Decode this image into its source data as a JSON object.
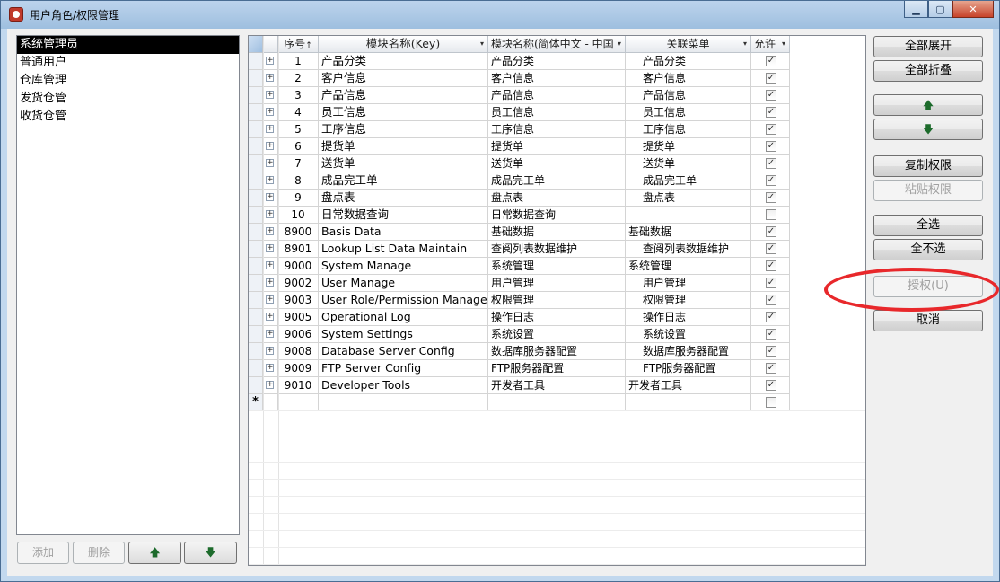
{
  "window": {
    "title": "用户角色/权限管理",
    "controls": {
      "minimize": "▁",
      "maximize": "▢",
      "close": "✕"
    }
  },
  "roles": {
    "items": [
      "系统管理员",
      "普通用户",
      "仓库管理",
      "发货仓管",
      "收货仓管"
    ],
    "selected_index": 0
  },
  "left_buttons": {
    "add": "添加",
    "delete": "删除",
    "up": "🡅",
    "down": "🡇"
  },
  "grid": {
    "columns": {
      "seq": "序号",
      "key": "模块名称(Key)",
      "cn": "模块名称(简体中文 - 中国",
      "menu": "关联菜单",
      "allow": "允许"
    },
    "sort_glyph": "↑",
    "dropdown_glyph": "▾",
    "expand_glyph": "+",
    "check_glyph": "✓",
    "new_row_marker": "*",
    "rows": [
      {
        "seq": "1",
        "key": "产品分类",
        "cn": "产品分类",
        "menu": "产品分类",
        "menu_indent": true,
        "allow": true
      },
      {
        "seq": "2",
        "key": "客户信息",
        "cn": "客户信息",
        "menu": "客户信息",
        "menu_indent": true,
        "allow": true
      },
      {
        "seq": "3",
        "key": "产品信息",
        "cn": "产品信息",
        "menu": "产品信息",
        "menu_indent": true,
        "allow": true
      },
      {
        "seq": "4",
        "key": "员工信息",
        "cn": "员工信息",
        "menu": "员工信息",
        "menu_indent": true,
        "allow": true
      },
      {
        "seq": "5",
        "key": "工序信息",
        "cn": "工序信息",
        "menu": "工序信息",
        "menu_indent": true,
        "allow": true
      },
      {
        "seq": "6",
        "key": "提货单",
        "cn": "提货单",
        "menu": "提货单",
        "menu_indent": true,
        "allow": true
      },
      {
        "seq": "7",
        "key": "送货单",
        "cn": "送货单",
        "menu": "送货单",
        "menu_indent": true,
        "allow": true
      },
      {
        "seq": "8",
        "key": "成品完工单",
        "cn": "成品完工单",
        "menu": "成品完工单",
        "menu_indent": true,
        "allow": true
      },
      {
        "seq": "9",
        "key": "盘点表",
        "cn": "盘点表",
        "menu": "盘点表",
        "menu_indent": true,
        "allow": true
      },
      {
        "seq": "10",
        "key": "日常数据查询",
        "cn": "日常数据查询",
        "menu": "",
        "menu_indent": true,
        "allow": false
      },
      {
        "seq": "8900",
        "key": "Basis Data",
        "cn": "基础数据",
        "menu": "基础数据",
        "menu_indent": false,
        "allow": true
      },
      {
        "seq": "8901",
        "key": "Lookup List Data Maintain",
        "cn": "查阅列表数据维护",
        "menu": "查阅列表数据维护",
        "menu_indent": true,
        "allow": true
      },
      {
        "seq": "9000",
        "key": "System Manage",
        "cn": "系统管理",
        "menu": "系统管理",
        "menu_indent": false,
        "allow": true
      },
      {
        "seq": "9002",
        "key": "User Manage",
        "cn": "用户管理",
        "menu": "用户管理",
        "menu_indent": true,
        "allow": true
      },
      {
        "seq": "9003",
        "key": "User Role/Permission Manage",
        "cn": "权限管理",
        "menu": "权限管理",
        "menu_indent": true,
        "allow": true
      },
      {
        "seq": "9005",
        "key": "Operational Log",
        "cn": "操作日志",
        "menu": "操作日志",
        "menu_indent": true,
        "allow": true
      },
      {
        "seq": "9006",
        "key": "System Settings",
        "cn": "系统设置",
        "menu": "系统设置",
        "menu_indent": true,
        "allow": true
      },
      {
        "seq": "9008",
        "key": "Database Server Config",
        "cn": "数据库服务器配置",
        "menu": "数据库服务器配置",
        "menu_indent": true,
        "allow": true
      },
      {
        "seq": "9009",
        "key": "FTP Server Config",
        "cn": "FTP服务器配置",
        "menu": "FTP服务器配置",
        "menu_indent": true,
        "allow": true
      },
      {
        "seq": "9010",
        "key": "Developer Tools",
        "cn": "开发者工具",
        "menu": "开发者工具",
        "menu_indent": false,
        "allow": true
      }
    ]
  },
  "right_buttons": {
    "expand_all": "全部展开",
    "collapse_all": "全部折叠",
    "move_up": "🡅",
    "move_down": "🡇",
    "copy_perm": "复制权限",
    "paste_perm": "粘贴权限",
    "select_all": "全选",
    "select_none": "全不选",
    "authorize": "授权(U)",
    "cancel": "取消"
  },
  "colors": {
    "highlight_ellipse": "#e8282b",
    "arrow_green": "#1d6b2c",
    "selection_bg": "#000000"
  }
}
